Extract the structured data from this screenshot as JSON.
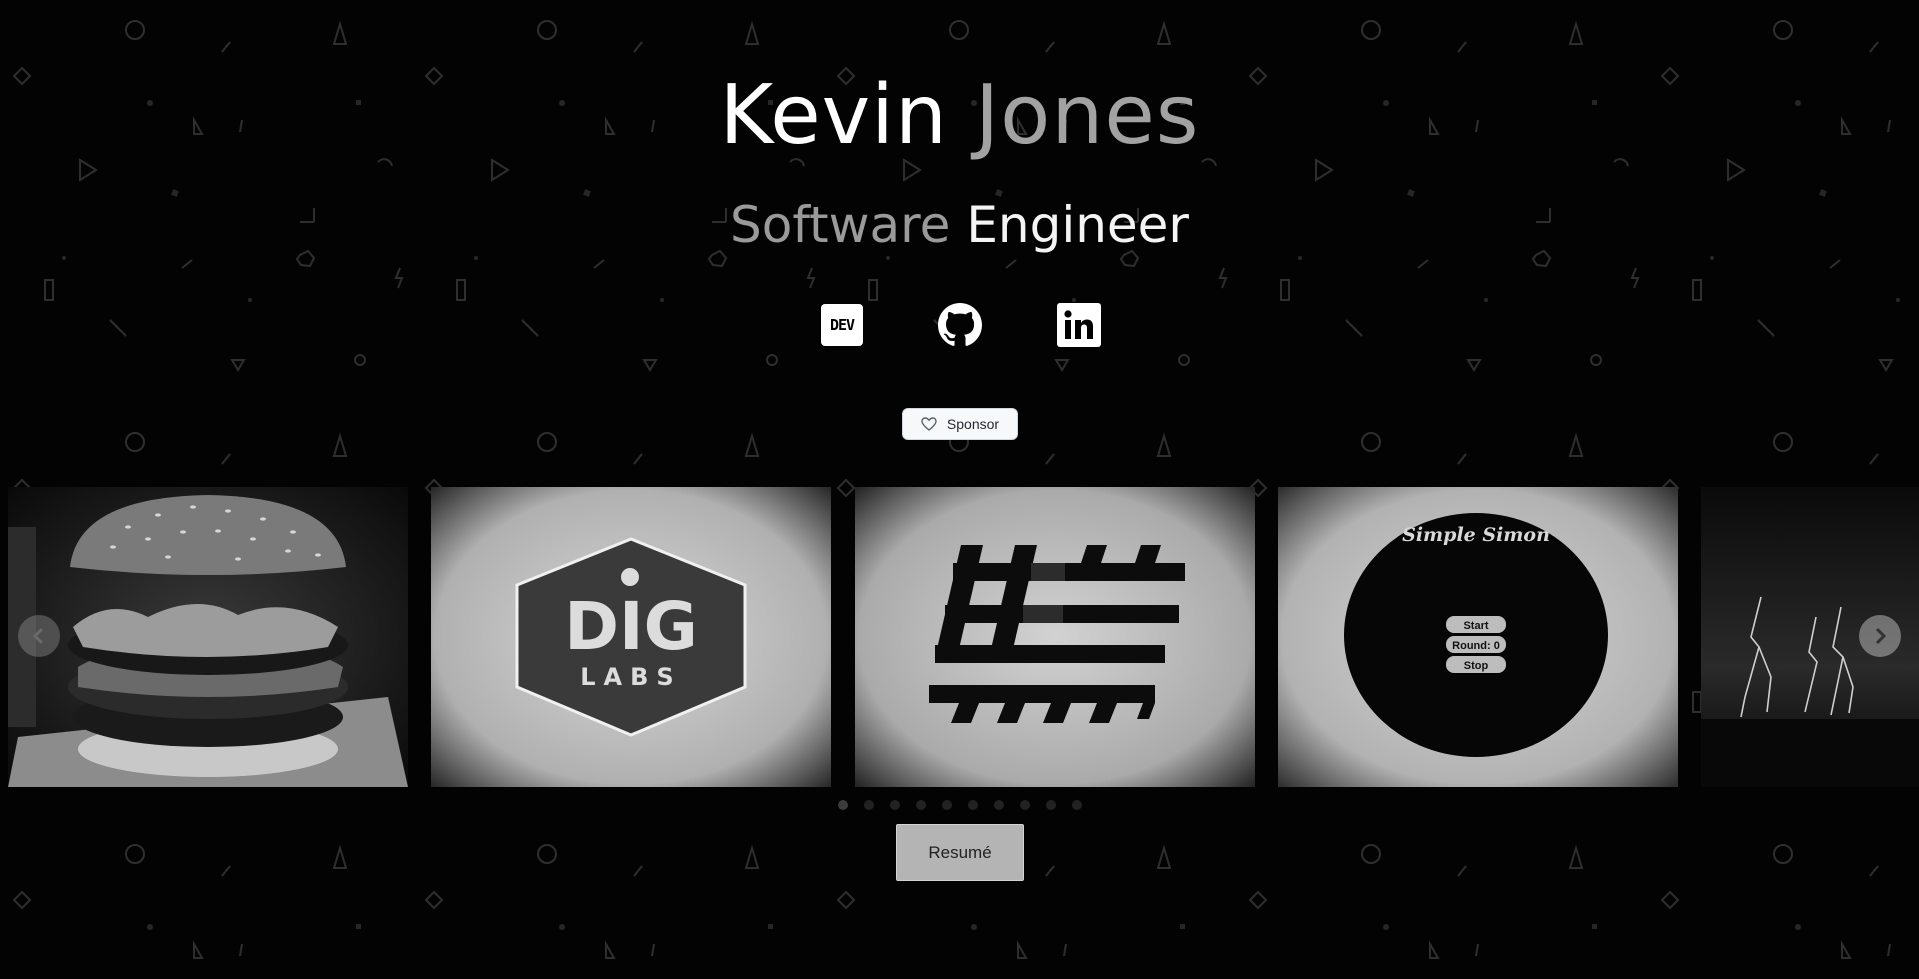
{
  "header": {
    "first_name": "Kevin",
    "last_name": "Jones",
    "role_first": "Software",
    "role_second": "Engineer"
  },
  "social": {
    "dev_text": "DEV",
    "dev_icon": "dev-to-icon",
    "github_icon": "github-icon",
    "linkedin_icon": "linkedin-icon"
  },
  "sponsor": {
    "label": "Sponsor",
    "icon": "heart-icon"
  },
  "carousel": {
    "slides": [
      {
        "subject": "burger-photo"
      },
      {
        "subject": "dig-labs-logo",
        "logo_text_main": "DIG",
        "logo_text_sub": "LABS"
      },
      {
        "subject": "hashtag-logo"
      },
      {
        "subject": "simple-simon-game",
        "title": "Simple Simon",
        "btn_start": "Start",
        "round": "Round: 0",
        "btn_stop": "Stop"
      },
      {
        "subject": "lightning-photo"
      }
    ],
    "dot_count": 10,
    "active_dot": 1
  },
  "resume": {
    "label": "Resumé"
  },
  "colors": {
    "background": "#030303",
    "name_first": "#ffffff",
    "name_last": "#a2a2a2",
    "role_first": "#9a9a9a",
    "role_second": "#f4f4f4"
  }
}
